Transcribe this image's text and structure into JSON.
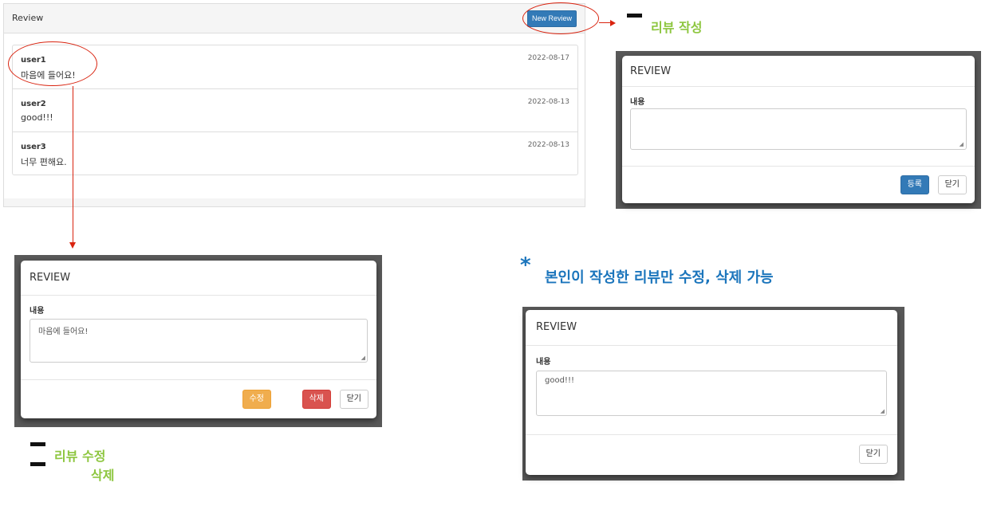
{
  "review_panel": {
    "title": "Review",
    "new_button_label": "New Review",
    "reviews": [
      {
        "user": "user1",
        "text": "마음에 들어요!",
        "date": "2022-08-17"
      },
      {
        "user": "user2",
        "text": "good!!!",
        "date": "2022-08-13"
      },
      {
        "user": "user3",
        "text": "너무 편해요.",
        "date": "2022-08-13"
      }
    ]
  },
  "captions": {
    "write": "리뷰 작성",
    "edit_line1": "리뷰 수정",
    "edit_line2": "삭제",
    "note_star": "*",
    "note": "본인이 작성한 리뷰만 수정, 삭제 가능"
  },
  "modal_write": {
    "title": "REVIEW",
    "label": "내용",
    "value": "",
    "submit_label": "등록",
    "close_label": "닫기"
  },
  "modal_edit": {
    "title": "REVIEW",
    "label": "내용",
    "value": "마음에 들어요!",
    "edit_label": "수정",
    "delete_label": "삭제",
    "close_label": "닫기"
  },
  "modal_view": {
    "title": "REVIEW",
    "label": "내용",
    "value": "good!!!",
    "close_label": "닫기"
  },
  "colors": {
    "primary": "#337ab7",
    "warning": "#f0ad4e",
    "danger": "#d9534f",
    "annotation_red": "#d9230f",
    "caption_green": "#8dc63f",
    "caption_blue": "#1b75bc"
  }
}
